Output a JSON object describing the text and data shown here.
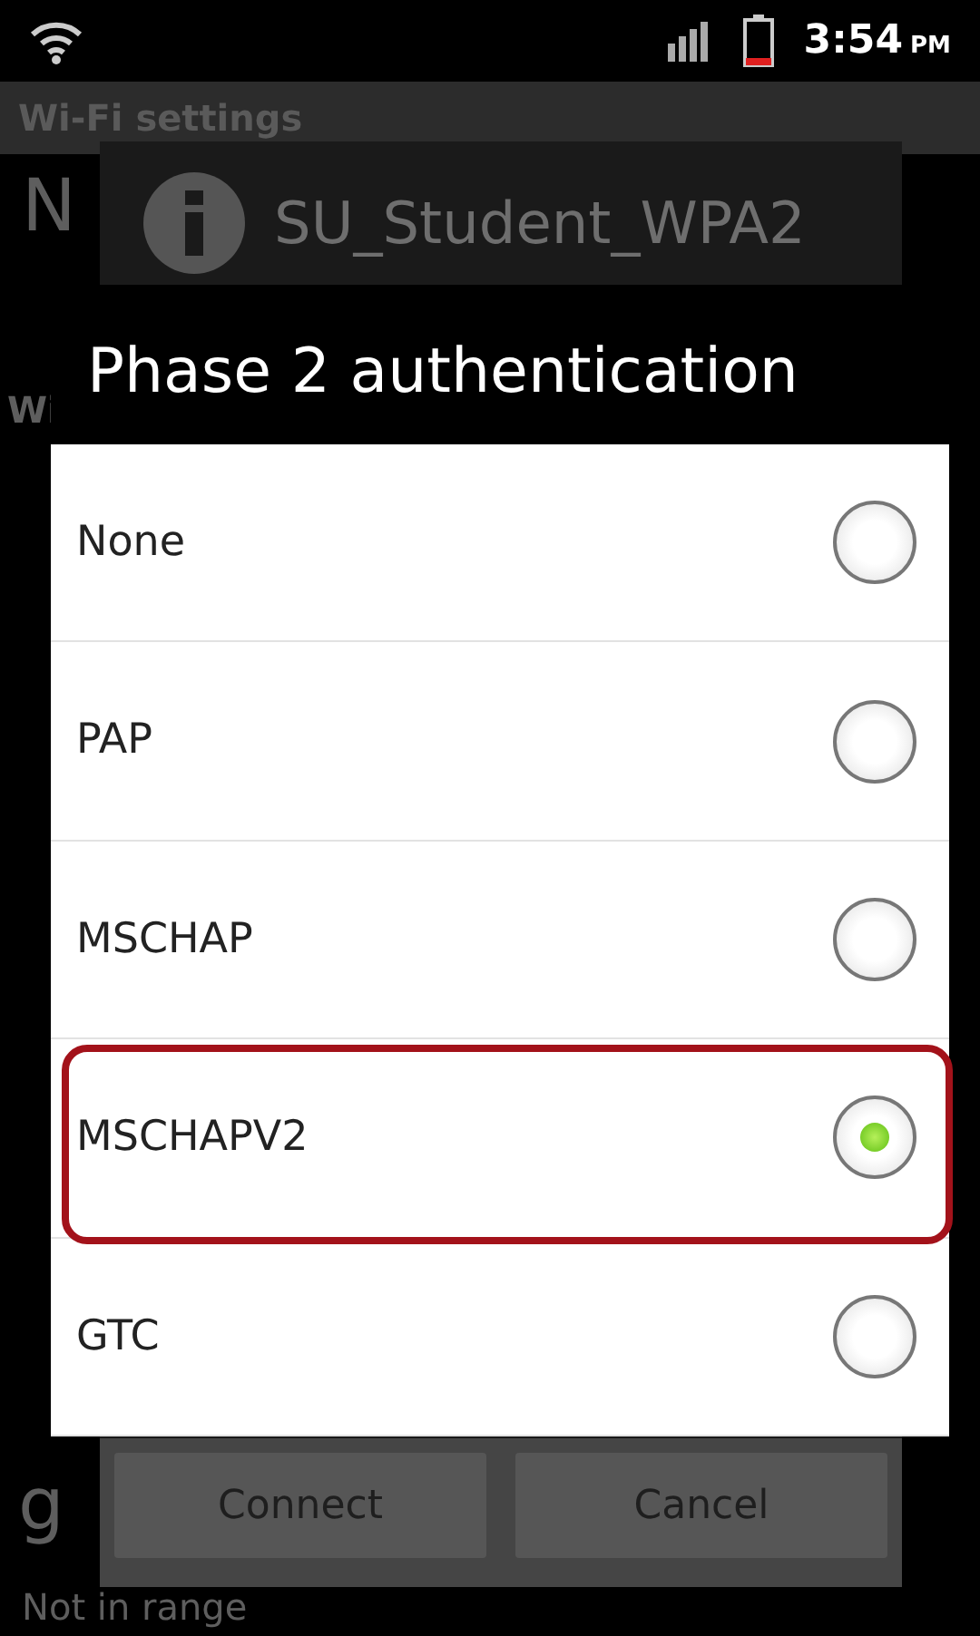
{
  "status_bar": {
    "time": "3:54",
    "ampm": "PM"
  },
  "background": {
    "title": "Wi-Fi settings",
    "fragments": [
      {
        "kind": "heading",
        "text": "N"
      },
      {
        "kind": "section",
        "text": "Wi"
      },
      {
        "kind": "heading",
        "text": "g"
      },
      {
        "kind": "sub",
        "text": "Not in range"
      }
    ]
  },
  "network_dialog": {
    "title": "SU_Student_WPA2",
    "buttons": [
      "Connect",
      "Cancel"
    ]
  },
  "phase2_dialog": {
    "title": "Phase 2 authentication",
    "options": [
      {
        "label": "None",
        "selected": false,
        "highlighted": false
      },
      {
        "label": "PAP",
        "selected": false,
        "highlighted": false
      },
      {
        "label": "MSCHAP",
        "selected": false,
        "highlighted": false
      },
      {
        "label": "MSCHAPV2",
        "selected": true,
        "highlighted": true
      },
      {
        "label": "GTC",
        "selected": false,
        "highlighted": false
      }
    ]
  }
}
